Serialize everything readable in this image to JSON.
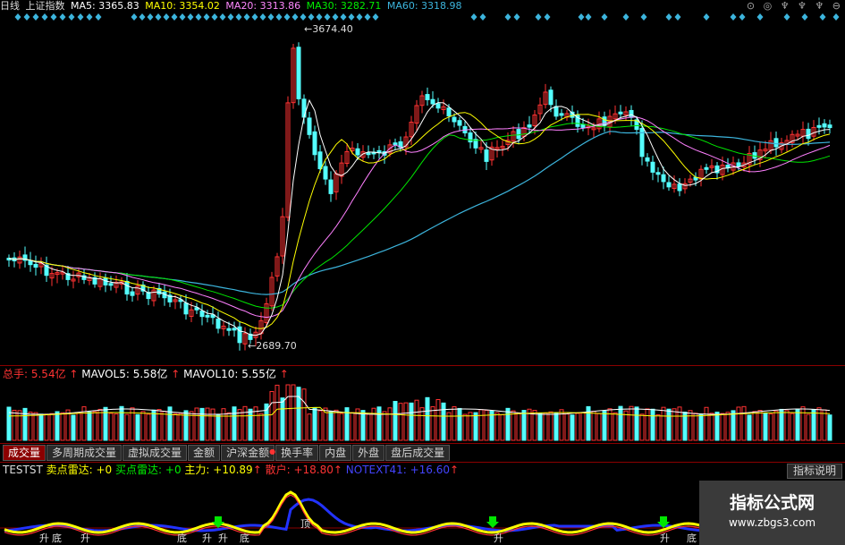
{
  "topbar": {
    "period": "日线",
    "symbol": "上证指数",
    "ma5": "MA5: 3365.83",
    "ma10": "MA10: 3354.02",
    "ma20": "MA20: 3313.86",
    "ma30": "MA30: 3282.71",
    "ma60": "MA60: 3318.98",
    "icons": "⊙ ◎ ♆ ♆ ♆ ⊖"
  },
  "price_panel": {
    "high_label": "3674.40",
    "low_label": "2689.70"
  },
  "volume_panel": {
    "total_label": "总手: ",
    "total_value": "5.54亿",
    "mavol5_label": "MAVOL5: ",
    "mavol5_value": "5.58亿",
    "mavol10_label": "MAVOL10: ",
    "mavol10_value": "5.55亿"
  },
  "tabs": [
    {
      "label": "成交量",
      "active": true
    },
    {
      "label": "多周期成交量"
    },
    {
      "label": "虚拟成交量"
    },
    {
      "label": "金额"
    },
    {
      "label": "沪深金额"
    },
    {
      "label": "换手率"
    },
    {
      "label": "内盘"
    },
    {
      "label": "外盘"
    },
    {
      "label": "盘后成交量"
    }
  ],
  "help_button": "指标说明",
  "indicator": {
    "name": "TESTST",
    "sell_label": "卖点雷达: ",
    "sell_value": "+0",
    "buy_label": "买点雷达: ",
    "buy_value": "+0",
    "main_label": "主力: ",
    "main_value": "+10.89",
    "retail_label": "散户: ",
    "retail_value": "+18.80",
    "notext_label": "NOTEXT41: ",
    "notext_value": "+16.60"
  },
  "markers": [
    "升",
    "底",
    "升",
    "底",
    "升",
    "升",
    "底",
    "顶",
    "升",
    "升",
    "底"
  ],
  "watermark": {
    "title": "指标公式网",
    "url": "www.zbgs3.com"
  },
  "colors": {
    "up": "#ff3232",
    "down": "#54ffff",
    "ma5": "#ffffff",
    "ma10": "#ffff00",
    "ma20": "#ff80ff",
    "ma30": "#00e600",
    "ma60": "#3cb4dc"
  }
}
